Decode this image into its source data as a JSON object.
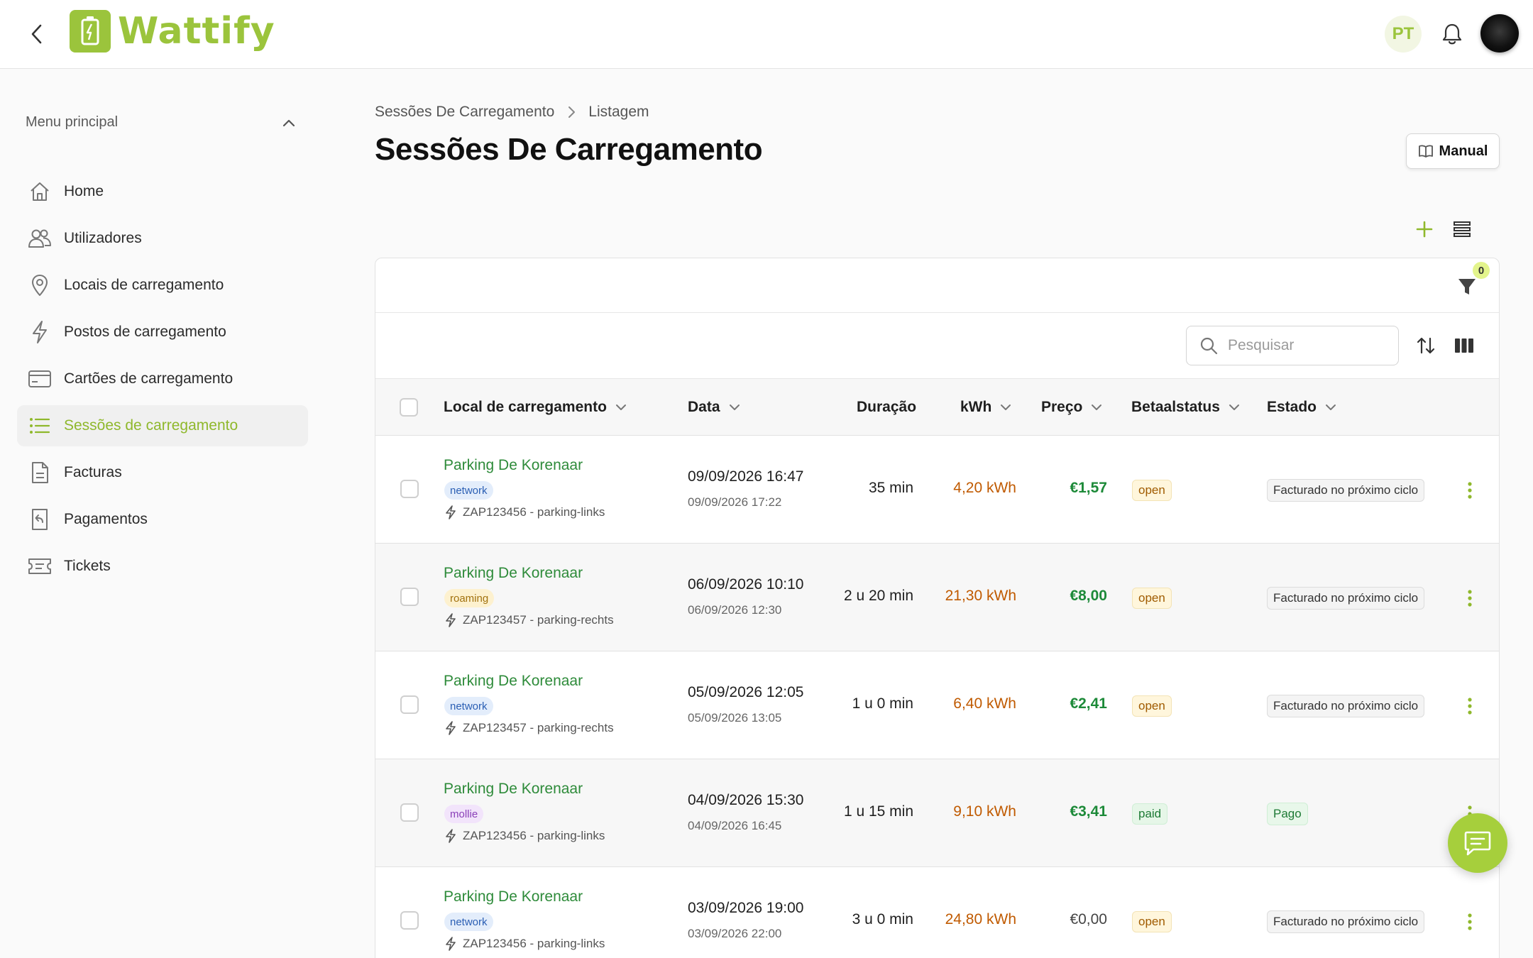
{
  "app": {
    "logo_text": "Wattify",
    "lang": "PT",
    "brand_color": "#9bc43c"
  },
  "sidebar": {
    "header": "Menu principal",
    "items": [
      {
        "label": "Home",
        "icon": "home-icon"
      },
      {
        "label": "Utilizadores",
        "icon": "users-icon"
      },
      {
        "label": "Locais de carregamento",
        "icon": "location-pin-icon"
      },
      {
        "label": "Postos de carregamento",
        "icon": "lightning-icon"
      },
      {
        "label": "Cartões de carregamento",
        "icon": "card-icon"
      },
      {
        "label": "Sessões de carregamento",
        "icon": "list-icon",
        "active": true
      },
      {
        "label": "Facturas",
        "icon": "document-icon"
      },
      {
        "label": "Pagamentos",
        "icon": "receipt-return-icon"
      },
      {
        "label": "Tickets",
        "icon": "ticket-icon"
      }
    ]
  },
  "breadcrumb": {
    "parent": "Sessões De Carregamento",
    "current": "Listagem"
  },
  "page": {
    "title": "Sessões De Carregamento",
    "manual_label": "Manual"
  },
  "filters": {
    "count": "0"
  },
  "search": {
    "placeholder": "Pesquisar"
  },
  "table": {
    "columns": {
      "location": "Local de carregamento",
      "date": "Data",
      "duration": "Duração",
      "kwh": "kWh",
      "price": "Preço",
      "paystatus": "Betaalstatus",
      "state": "Estado"
    },
    "rows": [
      {
        "location": "Parking De Korenaar",
        "tag": "network",
        "station": "ZAP123456 - parking-links",
        "start": "09/09/2026 16:47",
        "end": "09/09/2026 17:22",
        "duration": "35 min",
        "kwh": "4,20 kWh",
        "price": "€1,57",
        "paystatus": "open",
        "state": "Facturado no próximo ciclo"
      },
      {
        "location": "Parking De Korenaar",
        "tag": "roaming",
        "station": "ZAP123457 - parking-rechts",
        "start": "06/09/2026 10:10",
        "end": "06/09/2026 12:30",
        "duration": "2 u 20 min",
        "kwh": "21,30 kWh",
        "price": "€8,00",
        "paystatus": "open",
        "state": "Facturado no próximo ciclo"
      },
      {
        "location": "Parking De Korenaar",
        "tag": "network",
        "station": "ZAP123457 - parking-rechts",
        "start": "05/09/2026 12:05",
        "end": "05/09/2026 13:05",
        "duration": "1 u 0 min",
        "kwh": "6,40 kWh",
        "price": "€2,41",
        "paystatus": "open",
        "state": "Facturado no próximo ciclo"
      },
      {
        "location": "Parking De Korenaar",
        "tag": "mollie",
        "station": "ZAP123456 - parking-links",
        "start": "04/09/2026 15:30",
        "end": "04/09/2026 16:45",
        "duration": "1 u 15 min",
        "kwh": "9,10 kWh",
        "price": "€3,41",
        "paystatus": "paid",
        "state": "Pago"
      },
      {
        "location": "Parking De Korenaar",
        "tag": "network",
        "station": "ZAP123456 - parking-links",
        "start": "03/09/2026 19:00",
        "end": "03/09/2026 22:00",
        "duration": "3 u 0 min",
        "kwh": "24,80 kWh",
        "price": "€0,00",
        "paystatus": "open",
        "state": "Facturado no próximo ciclo"
      }
    ]
  }
}
